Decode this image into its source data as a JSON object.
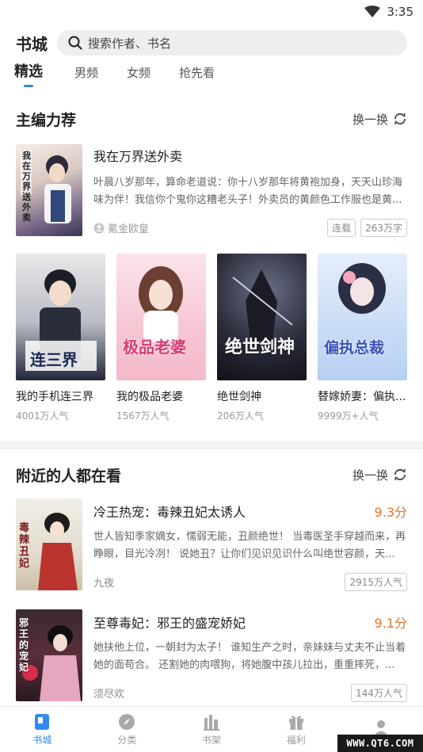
{
  "status": {
    "time": "3:35"
  },
  "header": {
    "title": "书城",
    "search_placeholder": "搜索作者、书名"
  },
  "tabs": [
    "精选",
    "男频",
    "女频",
    "抢先看"
  ],
  "editor_picks": {
    "title": "主编力荐",
    "refresh_label": "换一换",
    "featured": {
      "title": "我在万界送外卖",
      "cover_text": "我在万界送外卖",
      "desc": "叶晨八岁那年，算命老道说：你十八岁那年将黄袍加身，天天山珍海味为伴！我信你个鬼你这糟老头子！外卖员的黄颜色工作服也是黄...",
      "author": "氪金欧皇",
      "tags": [
        "连载",
        "263万字"
      ]
    },
    "grid": [
      {
        "title": "我的手机连三界",
        "sub": "4001万人气",
        "cover_text": "连三界"
      },
      {
        "title": "我的极品老婆",
        "sub": "1567万人气",
        "cover_text": "极品老婆"
      },
      {
        "title": "绝世剑神",
        "sub": "206万人气",
        "cover_text": "绝世剑神"
      },
      {
        "title": "替嫁娇妻：偏执...",
        "sub": "9999万+人气",
        "cover_text": "偏执总裁"
      }
    ]
  },
  "nearby": {
    "title": "附近的人都在看",
    "refresh_label": "换一换",
    "items": [
      {
        "title": "冷王热宠：毒辣丑妃太诱人",
        "score": "9.3分",
        "desc": "世人皆知季家嫡女，懦弱无能，丑颜绝世！ 当毒医圣手穿越而来，再睁眼，目光冷冽！ 说她丑？让你们见识见识什么叫绝世容颜，天...",
        "author": "九夜",
        "badge": "2915万人气",
        "cover_text": "毒辣丑妃"
      },
      {
        "title": "至尊毒妃：邪王的盛宠娇妃",
        "score": "9.1分",
        "desc": "她扶他上位，一朝封为太子！ 谁知生产之时，亲妹妹与丈夫不止当着她的面苟合。 还割她的肉喂狗，将她腹中孩儿拉出，重重摔死，...",
        "author": "须尽欢",
        "badge": "144万人气",
        "cover_text": "邪王的宠妃"
      }
    ]
  },
  "bottom_nav": [
    {
      "label": "书城",
      "icon": "book-icon",
      "active": true
    },
    {
      "label": "分类",
      "icon": "compass-icon",
      "active": false
    },
    {
      "label": "书架",
      "icon": "bookshelf-icon",
      "active": false
    },
    {
      "label": "福利",
      "icon": "gift-icon",
      "active": false
    },
    {
      "label": "",
      "icon": "user-icon",
      "active": false
    }
  ],
  "watermark": "WWW.QT6.COM",
  "colors": {
    "accent": "#2f8bf0",
    "score": "#e0762b"
  }
}
